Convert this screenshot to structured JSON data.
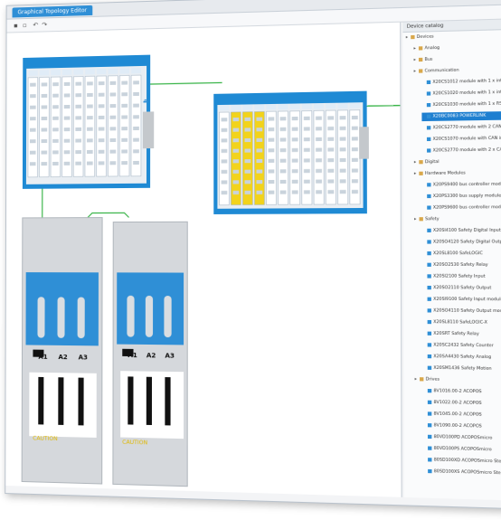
{
  "window": {
    "tab_title": "Graphical Topology Editor"
  },
  "toolbar": {
    "icons": [
      "save-icon",
      "print-icon",
      "undo-icon",
      "redo-icon"
    ]
  },
  "colors": {
    "blue": "#2f8fd6",
    "yellow": "#f2d31b",
    "green": "#3bb54a",
    "gray": "#d5d8dc",
    "select": "#1e7fd0"
  },
  "tree": {
    "header": "Device catalog",
    "items": [
      {
        "label": "Devices",
        "level": 0,
        "icon": "folder"
      },
      {
        "label": "Analog",
        "level": 1,
        "icon": "folder"
      },
      {
        "label": "Bus",
        "level": 1,
        "icon": "folder"
      },
      {
        "label": "Communication",
        "level": 1,
        "icon": "folder"
      },
      {
        "label": "X20CS1012 module with 1 x interface",
        "level": 2,
        "icon": "device"
      },
      {
        "label": "X20CS1020 module with 1 x interface, galvanically",
        "level": 2,
        "icon": "device"
      },
      {
        "label": "X20CS1030 module with 1 x RS232",
        "level": 2,
        "icon": "device"
      },
      {
        "label": "X20BC0083 POWERLINK",
        "level": 2,
        "icon": "device",
        "selected": true
      },
      {
        "label": "X20CS2770 module with 2 CAN interfaces",
        "level": 2,
        "icon": "device"
      },
      {
        "label": "X20CS1070 module with CAN interface",
        "level": 2,
        "icon": "device"
      },
      {
        "label": "X20CS2770 module with 2 x CAN interfaces",
        "level": 2,
        "icon": "device"
      },
      {
        "label": "Digital",
        "level": 1,
        "icon": "folder"
      },
      {
        "label": "Hardware Modules",
        "level": 1,
        "icon": "folder"
      },
      {
        "label": "X20PS9400 bus controller module",
        "level": 2,
        "icon": "device"
      },
      {
        "label": "X20PS3300 bus supply module",
        "level": 2,
        "icon": "device"
      },
      {
        "label": "X20PS9600 bus controller module",
        "level": 2,
        "icon": "device"
      },
      {
        "label": "Safety",
        "level": 1,
        "icon": "folder"
      },
      {
        "label": "X20SI4100 Safety Digital Input",
        "level": 2,
        "icon": "device"
      },
      {
        "label": "X20SO4120 Safety Digital Output",
        "level": 2,
        "icon": "device"
      },
      {
        "label": "X20SL8100 SafeLOGIC",
        "level": 2,
        "icon": "device"
      },
      {
        "label": "X20SO2530 Safety Relay",
        "level": 2,
        "icon": "device"
      },
      {
        "label": "X20SI2100 Safety Input",
        "level": 2,
        "icon": "device"
      },
      {
        "label": "X20SO2110 Safety Output",
        "level": 2,
        "icon": "device"
      },
      {
        "label": "X20SI9100 Safety Input module",
        "level": 2,
        "icon": "device"
      },
      {
        "label": "X20SO4110 Safety Output module",
        "level": 2,
        "icon": "device"
      },
      {
        "label": "X20SL8110 SafeLOGIC-X",
        "level": 2,
        "icon": "device"
      },
      {
        "label": "X20SRT Safety Relay",
        "level": 2,
        "icon": "device"
      },
      {
        "label": "X20SC2432 Safety Counter",
        "level": 2,
        "icon": "device"
      },
      {
        "label": "X20SA4430 Safety Analog",
        "level": 2,
        "icon": "device"
      },
      {
        "label": "X20SM1436 Safety Motion",
        "level": 2,
        "icon": "device"
      },
      {
        "label": "Drives",
        "level": 1,
        "icon": "folder"
      },
      {
        "label": "8V1016.00-2 ACOPOS",
        "level": 2,
        "icon": "device"
      },
      {
        "label": "8V1022.00-2 ACOPOS",
        "level": 2,
        "icon": "device"
      },
      {
        "label": "8V1045.00-2 ACOPOS",
        "level": 2,
        "icon": "device"
      },
      {
        "label": "8V1090.00-2 ACOPOS",
        "level": 2,
        "icon": "device"
      },
      {
        "label": "80VD100PD ACOPOSmicro",
        "level": 2,
        "icon": "device"
      },
      {
        "label": "80VD100PS ACOPOSmicro",
        "level": 2,
        "icon": "device"
      },
      {
        "label": "80SD100XD ACOPOSmicro Stepper",
        "level": 2,
        "icon": "device"
      },
      {
        "label": "80SD100XS ACOPOSmicro Stepper",
        "level": 2,
        "icon": "device"
      }
    ]
  },
  "drives": [
    {
      "axes": [
        "A1",
        "A2",
        "A3"
      ],
      "label": "CAUTION"
    },
    {
      "axes": [
        "A1",
        "A2",
        "A3"
      ],
      "label": "CAUTION"
    }
  ]
}
